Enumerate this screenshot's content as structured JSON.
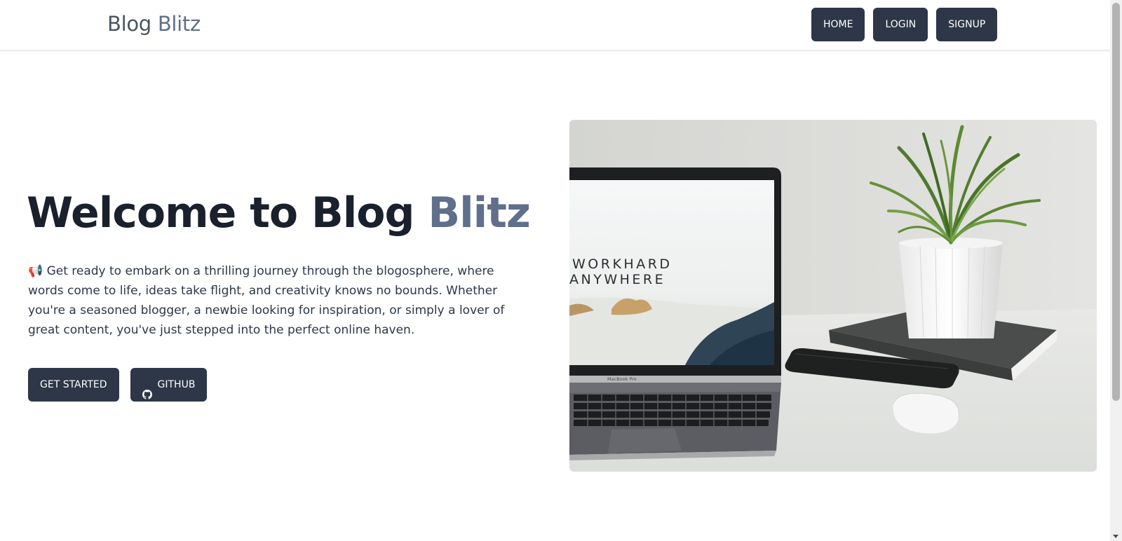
{
  "header": {
    "brand_primary": "Blog",
    "brand_accent": "Blitz",
    "nav": [
      {
        "label": "HOME"
      },
      {
        "label": "LOGIN"
      },
      {
        "label": "SIGNUP"
      }
    ]
  },
  "hero": {
    "title_primary": "Welcome to Blog",
    "title_accent": "Blitz",
    "description": "📢 Get ready to embark on a thrilling journey through the blogosphere, where words come to life, ideas take flight, and creativity knows no bounds. Whether you're a seasoned blogger, a newbie looking for inspiration, or simply a lover of great content, you've just stepped into the perfect online haven.",
    "buttons": {
      "get_started": "GET STARTED",
      "github": "GITHUB"
    },
    "image": {
      "screen_line1": "WORKHARD",
      "screen_line2": "ANYWHERE",
      "laptop_label": "MacBook Pro"
    }
  },
  "colors": {
    "dark": "#2d3748",
    "accent": "#5f6f8c",
    "heading": "#1a202c"
  }
}
